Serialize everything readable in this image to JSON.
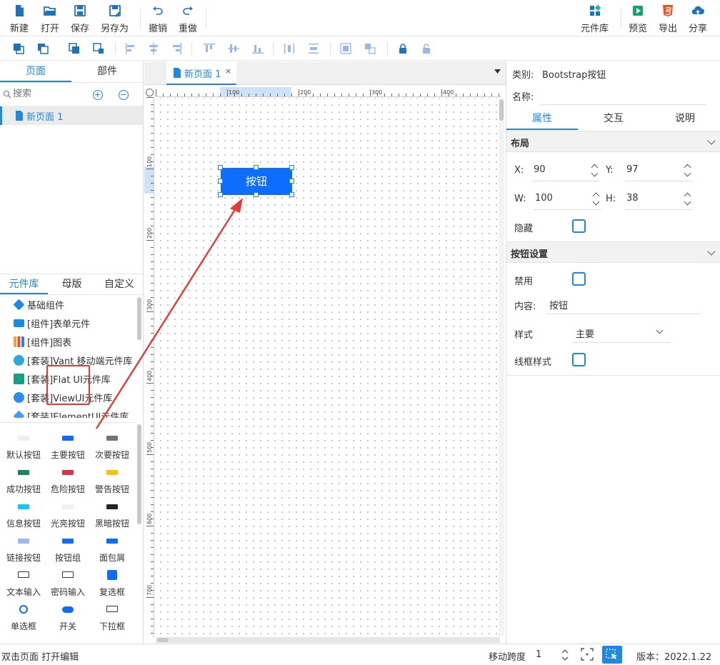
{
  "toolbar": {
    "new_label": "新建",
    "open_label": "打开",
    "save_label": "保存",
    "save_as_label": "另存为",
    "undo_label": "撤销",
    "redo_label": "重做",
    "library_label": "元件库",
    "preview_label": "预览",
    "export_label": "导出",
    "share_label": "分享"
  },
  "left_panel": {
    "tabs": [
      "页面",
      "部件"
    ],
    "search_placeholder": "搜索",
    "pages": [
      "新页面 1"
    ],
    "library_tabs": [
      "元件库",
      "母版",
      "自定义"
    ],
    "libraries": [
      {
        "label": "基础组件",
        "icon": "diamond-blue"
      },
      {
        "label": "[组件]表单元件",
        "icon": "form-blue"
      },
      {
        "label": "[组件]图表",
        "icon": "bar-chart-color"
      },
      {
        "label": "[套装]Vant 移动端元件库",
        "icon": "vant-blue"
      },
      {
        "label": "[套装]Flat UI元件库",
        "icon": "flat-green"
      },
      {
        "label": "[套装]ViewUI元件库",
        "icon": "viewui-blue"
      },
      {
        "label": "[套装]ElementUI元件库",
        "icon": "element-blue"
      }
    ],
    "components": [
      {
        "label": "默认按钮",
        "thumb": "#eeeeee"
      },
      {
        "label": "主要按钮",
        "thumb": "#0d6efd"
      },
      {
        "label": "次要按钮",
        "thumb": "#6c757d"
      },
      {
        "label": "成功按钮",
        "thumb": "#198754"
      },
      {
        "label": "危险按钮",
        "thumb": "#dc3545"
      },
      {
        "label": "警告按钮",
        "thumb": "#ffc107"
      },
      {
        "label": "信息按钮",
        "thumb": "#0dcaf0"
      },
      {
        "label": "光亮按钮",
        "thumb": "#f1f1f1"
      },
      {
        "label": "黑暗按钮",
        "thumb": "#212529"
      },
      {
        "label": "链接按钮",
        "thumb": "#9ab8f0"
      },
      {
        "label": "按钮组",
        "thumb": "#0d6efd"
      },
      {
        "label": "面包屑",
        "thumb": "#0d6efd"
      },
      {
        "label": "文本输入",
        "thumb": "#333333"
      },
      {
        "label": "密码输入",
        "thumb": "#333333"
      },
      {
        "label": "复选框",
        "thumb": "#0d6efd"
      },
      {
        "label": "单选框",
        "thumb": "#0d6efd"
      },
      {
        "label": "开关",
        "thumb": "#0d6efd"
      },
      {
        "label": "下拉框",
        "thumb": "#333333"
      }
    ]
  },
  "canvas": {
    "tab_title": "新页面 1",
    "tab_close": "×",
    "button_text": "按钮",
    "ruler_top_labels": [
      "100",
      "200",
      "300",
      "400"
    ],
    "ruler_left_labels": [
      "100",
      "200",
      "300",
      "400",
      "500",
      "600",
      "700"
    ]
  },
  "right_panel": {
    "category_label": "类别:",
    "category_value": "Bootstrap按钮",
    "name_label": "名称:",
    "tabs": [
      "属性",
      "交互",
      "说明"
    ],
    "layout_section": "布局",
    "x_label": "X:",
    "x_value": "90",
    "y_label": "Y:",
    "y_value": "97",
    "w_label": "W:",
    "w_value": "100",
    "h_label": "H:",
    "h_value": "38",
    "hidden_label": "隐藏",
    "button_section": "按钮设置",
    "disabled_label": "禁用",
    "content_label": "内容:",
    "content_value": "按钮",
    "style_label": "样式",
    "style_value": "主要",
    "outline_label": "线框样式"
  },
  "status_bar": {
    "hint": "双击页面 打开编辑",
    "move_step_label": "移动跨度",
    "move_step_value": "1",
    "version": "版本：2022.1.22"
  },
  "colors": {
    "accent": "#1e88e5",
    "primary_button": "#0d6efd",
    "annotation_red": "#e53935"
  }
}
